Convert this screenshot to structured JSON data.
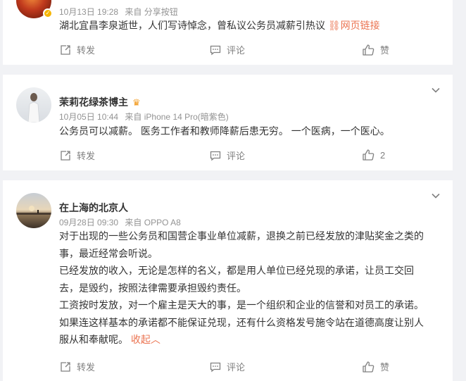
{
  "posts": [
    {
      "time": "10月13日 19:28",
      "source": "来自 分享按钮",
      "content": "湖北宜昌李泉逝世，人们写诗悼念，曾私议公务员减薪引热议",
      "link_label": "网页链接",
      "actions": {
        "repost": "转发",
        "comment": "评论",
        "like": "赞"
      }
    },
    {
      "username": "茉莉花绿茶博主",
      "time": "10月05日 10:44",
      "source": "来自 iPhone 14 Pro(暗紫色)",
      "content": "公务员可以减薪。 医务工作者和教师降薪后患无穷。 一个医病，一个医心。",
      "actions": {
        "repost": "转发",
        "comment": "评论",
        "like": "2"
      }
    },
    {
      "username": "在上海的北京人",
      "time": "09月28日 09:30",
      "source": "来自 OPPO A8",
      "paragraphs": [
        "对于出现的一些公务员和国营企事业单位减薪，退换之前已经发放的津贴奖金之类的事，最近经常会听说。",
        "已经发放的收入，无论是怎样的名义，都是用人单位已经兑现的承诺，让员工交回去，是毁约，按照法律需要承担毁约责任。",
        "工资按时发放，对一个雇主是天大的事，是一个组织和企业的信誉和对员工的承诺。如果连这样基本的承诺都不能保证兑现，还有什么资格发号施令站在道德高度让别人服从和奉献呢。"
      ],
      "collapse_label": "收起",
      "actions": {
        "repost": "转发",
        "comment": "评论",
        "like": "赞"
      }
    }
  ],
  "colors": {
    "link": "#eb7350",
    "meta": "#939393",
    "action": "#808080",
    "background": "#f1f2f5"
  },
  "icons": [
    "repost-icon",
    "comment-icon",
    "like-icon",
    "chevron-down-icon",
    "verified-badge-icon",
    "crown-icon",
    "link-icon"
  ]
}
